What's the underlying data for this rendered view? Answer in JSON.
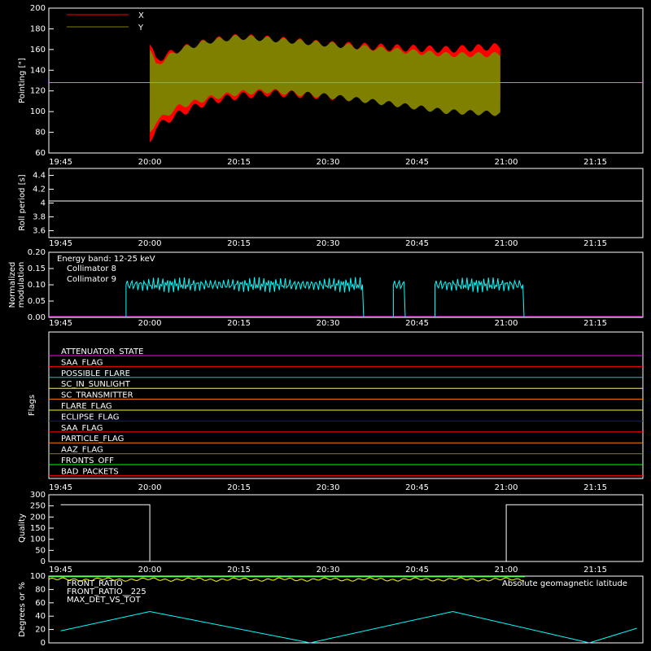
{
  "chart_data": [
    {
      "type": "area",
      "ylabel": "Pointing [\"]",
      "ylim": [
        60,
        200
      ],
      "yticks": [
        60,
        80,
        100,
        120,
        140,
        160,
        180,
        200
      ],
      "legend_placement": "top-left",
      "series": [
        {
          "name": "X",
          "color": "#ff0000",
          "x": [
            "20:00",
            "20:01",
            "20:05",
            "20:10",
            "20:15",
            "20:20",
            "20:30",
            "20:40",
            "20:50",
            "20:59"
          ],
          "upper": [
            165,
            150,
            160,
            168,
            172,
            170,
            165,
            162,
            160,
            163
          ],
          "lower": [
            70,
            85,
            98,
            110,
            115,
            118,
            115,
            110,
            108,
            110
          ]
        },
        {
          "name": "Y",
          "color": "#808000",
          "x": [
            "20:00",
            "20:01",
            "20:05",
            "20:10",
            "20:15",
            "20:20",
            "20:30",
            "20:40",
            "20:50",
            "20:59"
          ],
          "upper": [
            160,
            145,
            160,
            168,
            172,
            170,
            165,
            160,
            155,
            155
          ],
          "lower": [
            80,
            90,
            105,
            113,
            118,
            120,
            115,
            108,
            100,
            98
          ]
        }
      ],
      "baseline": 128,
      "xlabels": [
        "19:45",
        "20:00",
        "20:15",
        "20:30",
        "20:45",
        "21:00",
        "21:15"
      ]
    },
    {
      "type": "line",
      "ylabel": "Roll period [s]",
      "ylim": [
        3.5,
        4.5
      ],
      "yticks": [
        3.6,
        3.8,
        4.0,
        4.2,
        4.4
      ],
      "value": 4.03,
      "xlabels": [
        "19:45",
        "20:00",
        "20:15",
        "20:30",
        "20:45",
        "21:00",
        "21:15"
      ]
    },
    {
      "type": "line",
      "ylabel": [
        "Normalized",
        "modulation"
      ],
      "ylim": [
        0,
        0.2
      ],
      "yticks": [
        "0.00",
        "0.05",
        "0.10",
        "0.15",
        "0.20"
      ],
      "annotation": "Energy band: 12-25 keV",
      "series": [
        {
          "name": "Collimator 8",
          "color": "#00ffff",
          "segments": [
            [
              "19:56",
              "20:36"
            ],
            [
              "20:41",
              "20:43"
            ],
            [
              "20:48",
              "21:03"
            ]
          ],
          "level": 0.1
        },
        {
          "name": "Collimator 9",
          "color": "#ff00ff",
          "level": 0.0
        }
      ],
      "xlabels": [
        "19:45",
        "20:00",
        "20:15",
        "20:30",
        "20:45",
        "21:00",
        "21:15"
      ]
    },
    {
      "type": "table",
      "ylabel": "Flags",
      "flags": [
        {
          "name": "ATTENUATOR_STATE",
          "color": "#ff00ff"
        },
        {
          "name": "SAA_FLAG",
          "color": "#ff0000"
        },
        {
          "name": "POSSIBLE_FLARE",
          "color": "#00cccc"
        },
        {
          "name": "SC_IN_SUNLIGHT",
          "color": "#ffff00"
        },
        {
          "name": "SC_TRANSMITTER",
          "color": "#ff8000"
        },
        {
          "name": "FLARE_FLAG",
          "color": "#ffff00"
        },
        {
          "name": "ECLIPSE_FLAG",
          "color": "#0000ff"
        },
        {
          "name": "SAA_FLAG",
          "color": "#ff0000"
        },
        {
          "name": "PARTICLE_FLAG",
          "color": "#ff8000"
        },
        {
          "name": "AAZ_FLAG",
          "color": "#808000"
        },
        {
          "name": "FRONTS_OFF",
          "color": "#00ff00"
        },
        {
          "name": "BAD_PACKETS",
          "color": "#ff0000"
        }
      ],
      "xlabels": [
        "19:45",
        "20:00",
        "20:15",
        "20:30",
        "20:45",
        "21:00",
        "21:15"
      ]
    },
    {
      "type": "line",
      "ylabel": "Quality",
      "ylim": [
        0,
        300
      ],
      "yticks": [
        0,
        50,
        100,
        150,
        200,
        250,
        300
      ],
      "segments": [
        {
          "from": "19:45",
          "to": "20:00",
          "value": 255
        },
        {
          "from": "20:00",
          "to": "21:00",
          "value": 0
        },
        {
          "from": "21:00",
          "to": "21:23",
          "value": 255
        }
      ],
      "xlabels": [
        "19:45",
        "20:00",
        "20:15",
        "20:30",
        "20:45",
        "21:00",
        "21:15"
      ]
    },
    {
      "type": "line",
      "ylabel": "Degrees or %",
      "ylim": [
        0,
        100
      ],
      "yticks": [
        0,
        20,
        40,
        60,
        80,
        100
      ],
      "series": [
        {
          "name": "FRONT_RATIO",
          "color": "#ffff00",
          "level": 95
        },
        {
          "name": "FRONT_RATIO__225",
          "color": "#00ff00"
        },
        {
          "name": "MAX_DET_VS_TOT",
          "color": "#ff8000"
        },
        {
          "name": "Absolute geomagnetic latitude",
          "color": "#00ffff",
          "x": [
            "19:45",
            "20:00",
            "20:27",
            "20:51",
            "21:14",
            "21:22"
          ],
          "y": [
            18,
            47,
            0,
            47,
            0,
            22
          ]
        }
      ]
    }
  ]
}
